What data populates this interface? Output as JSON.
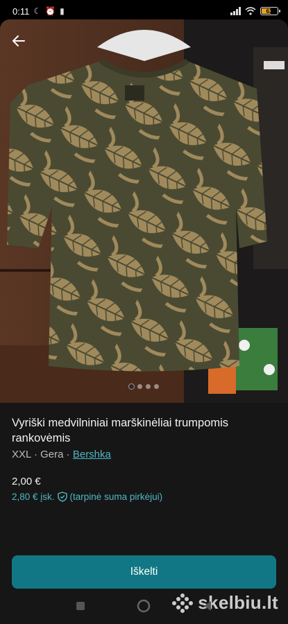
{
  "status_bar": {
    "time": "0:11",
    "icons": [
      "moon-icon",
      "alarm-icon",
      "battery-saver-icon",
      "signal-icon",
      "wifi-icon",
      "battery-icon"
    ],
    "battery_level": "63"
  },
  "photo": {
    "image_count": 4,
    "active_index": 0
  },
  "listing": {
    "title": "Vyriški medvilniniai marškinėliai trumpomis rankovėmis",
    "size": "XXL",
    "separator": "·",
    "condition": "Gera",
    "brand": "Bershka",
    "price": "2,00 €",
    "price_incl": "2,80 € įsk.",
    "price_incl_note": "(tarpinė suma pirkėjui)"
  },
  "actions": {
    "primary_label": "Iškelti"
  },
  "watermark": {
    "text": "skelbiu.lt"
  },
  "colors": {
    "accent": "#117784",
    "link": "#4fb7c4",
    "background": "#161616"
  }
}
